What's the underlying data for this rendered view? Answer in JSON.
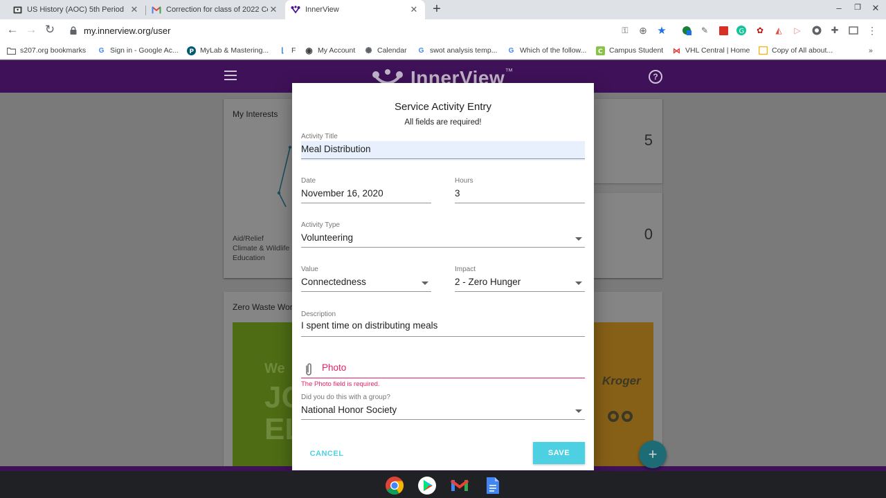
{
  "browser": {
    "tabs": [
      {
        "title": "US History (AOC) 5th Period",
        "icon": "classroom-icon"
      },
      {
        "title": "Correction for class of 2022 Cou",
        "icon": "gmail-icon"
      },
      {
        "title": "InnerView",
        "icon": "innerview-icon",
        "active": true
      }
    ],
    "url": "my.innerview.org/user",
    "bookmarks": [
      {
        "label": "s207.org bookmarks",
        "icon": "folder-icon"
      },
      {
        "label": "Sign in - Google Ac...",
        "icon": "google-icon"
      },
      {
        "label": "MyLab & Mastering...",
        "icon": "pearson-icon"
      },
      {
        "label": "F",
        "icon": "bookmark-icon"
      },
      {
        "label": "My Account",
        "icon": "globe-icon"
      },
      {
        "label": "Calendar",
        "icon": "calendar-icon"
      },
      {
        "label": "swot analysis temp...",
        "icon": "google-icon"
      },
      {
        "label": "Which of the follow...",
        "icon": "google-icon"
      },
      {
        "label": "Campus Student",
        "icon": "campus-icon"
      },
      {
        "label": "VHL Central | Home",
        "icon": "vhl-icon"
      },
      {
        "label": "Copy of All about...",
        "icon": "slides-icon"
      }
    ],
    "overflow": "»"
  },
  "app": {
    "logo": "InnerView",
    "logo_tm": "™",
    "help": "?"
  },
  "background": {
    "interests_title": "My Interests",
    "interests_legend": [
      "Aid/Relief",
      "Climate & Wildlife",
      "Education"
    ],
    "stat_top": "5",
    "stat_bottom": "0",
    "zero_waste_title": "Zero Waste Wor",
    "promo_text": [
      "We",
      "JO",
      "EL"
    ],
    "promo_brand": "Kroger",
    "fab": "+"
  },
  "dialog": {
    "title": "Service Activity Entry",
    "subtitle": "All fields are required!",
    "activity_title": {
      "label": "Activity Title",
      "value": "Meal Distribution"
    },
    "date": {
      "label": "Date",
      "value": "November 16, 2020"
    },
    "hours": {
      "label": "Hours",
      "value": "3"
    },
    "activity_type": {
      "label": "Activity Type",
      "value": "Volunteering"
    },
    "value_field": {
      "label": "Value",
      "value": "Connectedness"
    },
    "impact": {
      "label": "Impact",
      "value": "2 - Zero Hunger"
    },
    "description": {
      "label": "Description",
      "value": "I spent time on distributing meals"
    },
    "photo": {
      "label": "Photo",
      "error": "The Photo field is required."
    },
    "group": {
      "label": "Did you do this with a group?",
      "value": "National Honor Society"
    },
    "cancel_label": "CANCEL",
    "save_label": "SAVE",
    "accent_color": "#4dd0e1",
    "error_color": "#e91e63"
  }
}
